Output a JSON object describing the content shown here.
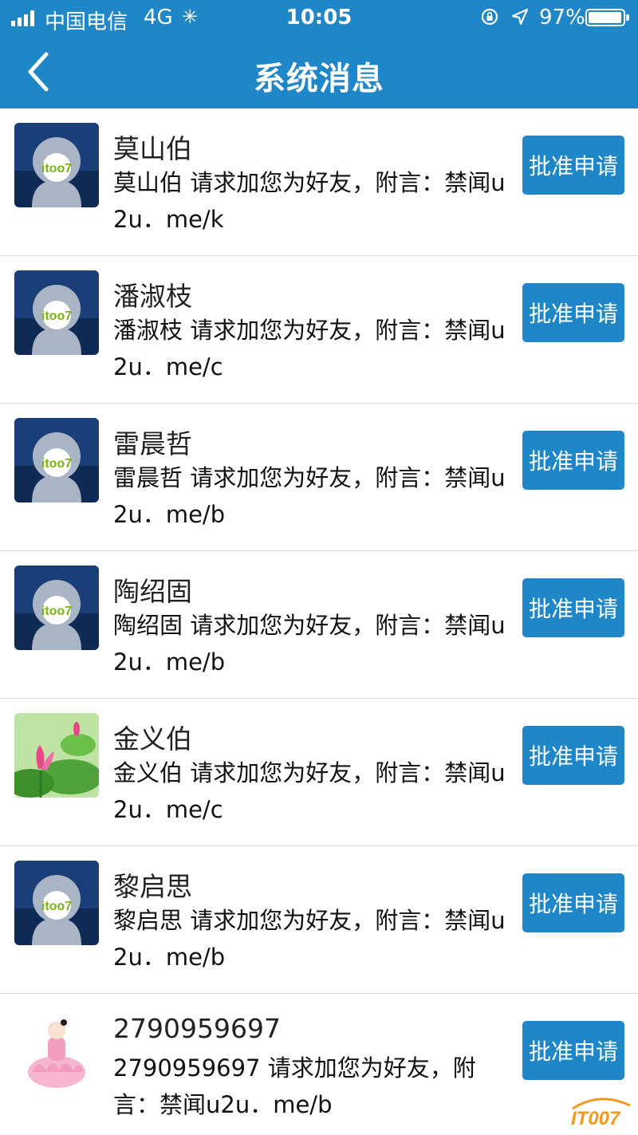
{
  "status_bar": {
    "carrier": "中国电信",
    "network": "4G",
    "time": "10:05",
    "battery": "97%",
    "battery_level": 0.97
  },
  "nav": {
    "title": "系统消息"
  },
  "colors": {
    "primary": "#1f86c8",
    "divider": "#dcdcdc"
  },
  "messages": [
    {
      "name": "莫山伯",
      "text": "莫山伯 请求加您为好友，附言：禁闻u2u．me/k",
      "button": "批准申请",
      "avatar": "itoo7-default-avatar",
      "avatar_text": "itoo7"
    },
    {
      "name": "潘淑枝",
      "text": "潘淑枝 请求加您为好友，附言：禁闻u2u．me/c",
      "button": "批准申请",
      "avatar": "itoo7-default-avatar",
      "avatar_text": "itoo7"
    },
    {
      "name": "雷晨哲",
      "text": "雷晨哲 请求加您为好友，附言：禁闻u2u．me/b",
      "button": "批准申请",
      "avatar": "itoo7-default-avatar",
      "avatar_text": "itoo7"
    },
    {
      "name": "陶绍固",
      "text": "陶绍固 请求加您为好友，附言：禁闻u2u．me/b",
      "button": "批准申请",
      "avatar": "itoo7-default-avatar",
      "avatar_text": "itoo7"
    },
    {
      "name": "金义伯",
      "text": "金义伯 请求加您为好友，附言：禁闻u2u．me/c",
      "button": "批准申请",
      "avatar": "lotus-photo-avatar"
    },
    {
      "name": "黎启思",
      "text": "黎启思 请求加您为好友，附言：禁闻u2u．me/b",
      "button": "批准申请",
      "avatar": "itoo7-default-avatar",
      "avatar_text": "itoo7"
    },
    {
      "name": "2790959697",
      "text": "2790959697 请求加您为好友，附言：禁闻u2u．me/b",
      "button": "批准申请",
      "avatar": "girl-on-lotus-avatar"
    }
  ],
  "watermark": "IT007"
}
